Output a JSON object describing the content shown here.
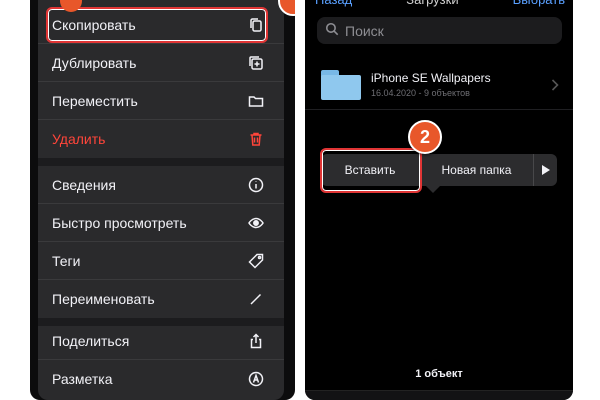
{
  "menu": {
    "items": [
      {
        "label": "Скопировать",
        "icon": "copy-icon"
      },
      {
        "label": "Дублировать",
        "icon": "duplicate-icon"
      },
      {
        "label": "Переместить",
        "icon": "folder-icon"
      },
      {
        "label": "Удалить",
        "icon": "trash-icon",
        "color": "#ff453a"
      },
      {
        "label": "Сведения",
        "icon": "info-icon"
      },
      {
        "label": "Быстро просмотреть",
        "icon": "eye-icon"
      },
      {
        "label": "Теги",
        "icon": "tag-icon"
      },
      {
        "label": "Переименовать",
        "icon": "pencil-icon"
      },
      {
        "label": "Поделиться",
        "icon": "share-icon"
      },
      {
        "label": "Разметка",
        "icon": "markup-icon"
      }
    ],
    "step_badge": ""
  },
  "files": {
    "nav": {
      "back": "Назад",
      "title": "Загрузки",
      "right": "Выбрать"
    },
    "search": {
      "placeholder": "Поиск"
    },
    "folder": {
      "name": "iPhone SE Wallpapers",
      "subtitle": "16.04.2020 - 9 объектов"
    },
    "paste_menu": {
      "paste": "Вставить",
      "new_folder": "Новая папка"
    },
    "step_badge": "2",
    "count": "1 объект"
  },
  "colors": {
    "highlight": "#e03535",
    "badge": "#e8572a",
    "accent": "#5aa0ff",
    "danger": "#ff453a"
  }
}
